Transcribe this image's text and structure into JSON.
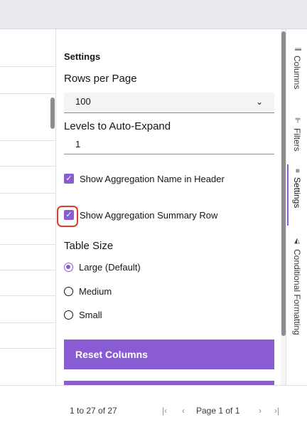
{
  "panel": {
    "title": "Settings",
    "rows_per_page": {
      "label": "Rows per Page",
      "value": "100"
    },
    "auto_expand": {
      "label": "Levels to Auto-Expand",
      "value": "1"
    },
    "checkboxes": [
      {
        "label": "Show Aggregation Name in Header",
        "checked": true
      },
      {
        "label": "Show Aggregation Summary Row",
        "checked": true
      }
    ],
    "table_size": {
      "label": "Table Size",
      "options": [
        {
          "label": "Large (Default)",
          "selected": true
        },
        {
          "label": "Medium",
          "selected": false
        },
        {
          "label": "Small",
          "selected": false
        }
      ]
    },
    "reset_button": "Reset Columns"
  },
  "side_tabs": [
    {
      "label": "Columns",
      "icon": "columns-icon",
      "glyph": "⫼",
      "active": false
    },
    {
      "label": "Filters",
      "icon": "filter-icon",
      "glyph": "⊩",
      "active": false
    },
    {
      "label": "Settings",
      "icon": "settings-lines-icon",
      "glyph": "≡",
      "active": true
    },
    {
      "label": "Conditional Formatting",
      "icon": "paint-bucket-icon",
      "glyph": "◭",
      "active": false
    }
  ],
  "pagination": {
    "range": "1 to 27 of 27",
    "page_info": "Page 1 of 1",
    "first_icon": "first-page-icon",
    "prev_icon": "previous-page-icon",
    "next_icon": "next-page-icon",
    "last_icon": "last-page-icon"
  },
  "colors": {
    "accent": "#8a5cd4",
    "highlight": "#e03b2b"
  }
}
